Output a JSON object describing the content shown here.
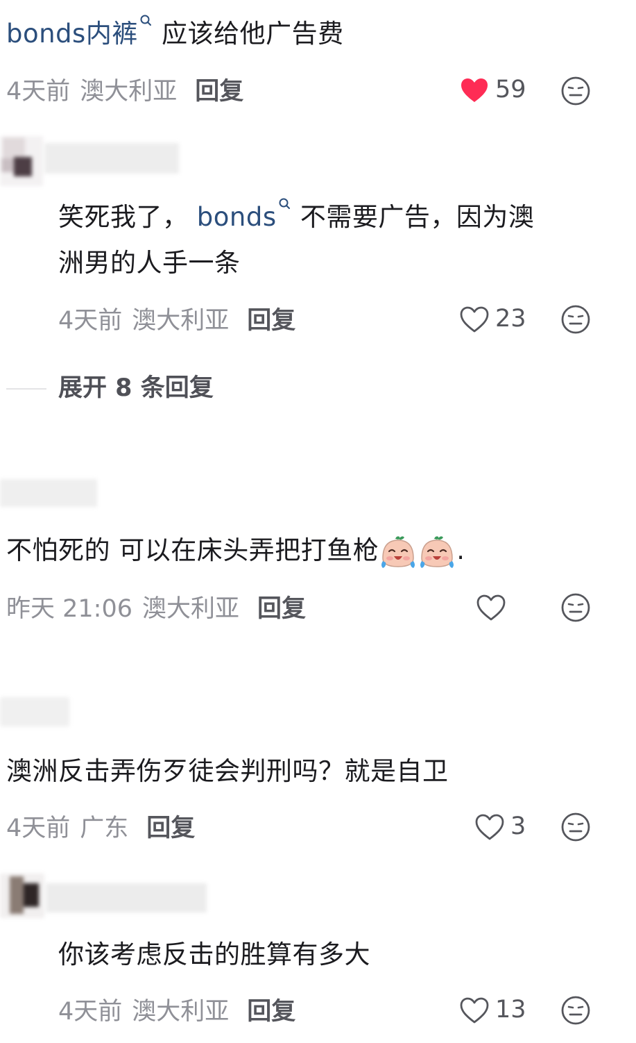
{
  "comments": [
    {
      "text_link": "bonds内裤",
      "text_rest": "应该给他广告费",
      "time": "4天前",
      "location": "澳大利亚",
      "reply_label": "回复",
      "likes": "59",
      "liked": true
    },
    {
      "text_before": "笑死我了，",
      "text_link": "bonds",
      "text_after": "不需要广告，因为澳",
      "text_line2": "洲男的人手一条",
      "time": "4天前",
      "location": "澳大利亚",
      "reply_label": "回复",
      "likes": "23",
      "liked": false
    },
    {
      "text": "不怕死的 可以在床头弄把打鱼枪",
      "text_tail": ".",
      "time": "昨天 21:06",
      "location": "澳大利亚",
      "reply_label": "回复",
      "likes": "",
      "liked": false
    },
    {
      "text": "澳洲反击弄伤歹徒会判刑吗？就是自卫",
      "time": "4天前",
      "location": "广东",
      "reply_label": "回复",
      "likes": "3",
      "liked": false
    },
    {
      "text": "你该考虑反击的胜算有多大",
      "time": "4天前",
      "location": "澳大利亚",
      "reply_label": "回复",
      "likes": "13",
      "liked": false
    }
  ],
  "expand_replies": "展开 8 条回复",
  "icons": {
    "heart": "heart-icon",
    "heart_filled": "heart-filled-icon",
    "dislike": "meh-face-icon",
    "search": "search-icon",
    "emoji": "crying-laugh-emoji"
  },
  "colors": {
    "liked_heart": "#fe2c55",
    "link": "#2b4e7c",
    "meta": "#8f9097"
  }
}
